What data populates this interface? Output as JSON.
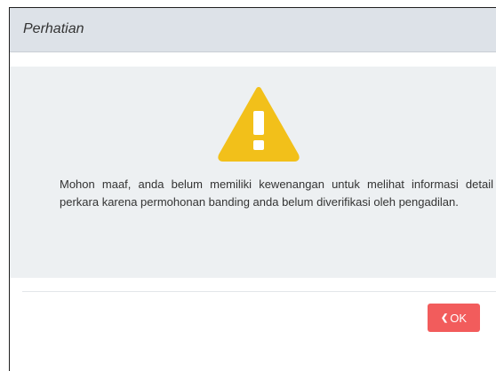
{
  "dialog": {
    "title": "Perhatian",
    "message": "Mohon maaf, anda belum memiliki kewenangan untuk melihat informasi detail perkara karena permohonan banding anda belum diverifikasi oleh pengadilan.",
    "warning_icon": "warning-triangle-icon",
    "ok_icon": "chevron-left-icon",
    "ok_label": "OK"
  },
  "colors": {
    "header_bg": "#dde2e8",
    "body_bg": "#edf0f2",
    "warning": "#f2c01a",
    "ok_button": "#f25c5c"
  }
}
